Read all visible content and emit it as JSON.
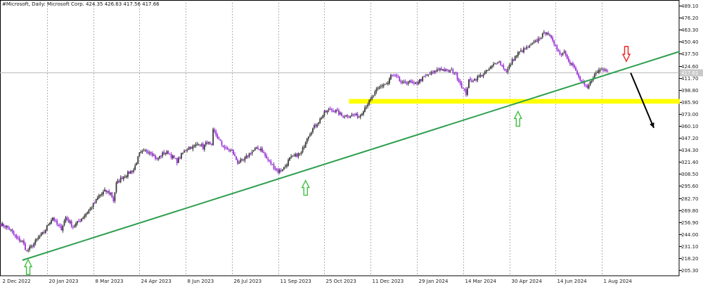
{
  "chart_data": {
    "type": "candlestick",
    "header": "#Microsoft, Daily:  Microsoft Corp.   424.35 426.63 417.56 417.66",
    "current_price_label": "417.61",
    "current_price": 417.61,
    "ylim": [
      199.3,
      495.2
    ],
    "y_ticks": [
      {
        "value": 489.1,
        "label": "489.10"
      },
      {
        "value": 476.2,
        "label": "476.20"
      },
      {
        "value": 463.3,
        "label": "463.30"
      },
      {
        "value": 450.4,
        "label": "450.40"
      },
      {
        "value": 437.5,
        "label": "437.50"
      },
      {
        "value": 424.6,
        "label": "424.60"
      },
      {
        "value": 411.7,
        "label": "411.70"
      },
      {
        "value": 398.8,
        "label": "398.80"
      },
      {
        "value": 385.9,
        "label": "385.90"
      },
      {
        "value": 373.0,
        "label": "373.00"
      },
      {
        "value": 360.1,
        "label": "360.10"
      },
      {
        "value": 347.2,
        "label": "347.20"
      },
      {
        "value": 334.3,
        "label": "334.30"
      },
      {
        "value": 321.4,
        "label": "321.40"
      },
      {
        "value": 308.5,
        "label": "308.50"
      },
      {
        "value": 295.6,
        "label": "295.60"
      },
      {
        "value": 282.7,
        "label": "282.70"
      },
      {
        "value": 269.8,
        "label": "269.80"
      },
      {
        "value": 256.9,
        "label": "256.90"
      },
      {
        "value": 244.0,
        "label": "244.00"
      },
      {
        "value": 231.1,
        "label": "231.10"
      },
      {
        "value": 218.2,
        "label": "218.20"
      },
      {
        "value": 205.3,
        "label": "205.30"
      }
    ],
    "x_ticks": [
      {
        "bar": 0,
        "label": "2 Dec 2022"
      },
      {
        "bar": 32,
        "label": "20 Jan 2023"
      },
      {
        "bar": 64,
        "label": "8 Mar 2023"
      },
      {
        "bar": 96,
        "label": "24 Apr 2023"
      },
      {
        "bar": 128,
        "label": "8 Jun 2023"
      },
      {
        "bar": 160,
        "label": "26 Jul 2023"
      },
      {
        "bar": 192,
        "label": "11 Sep 2023"
      },
      {
        "bar": 224,
        "label": "25 Oct 2023"
      },
      {
        "bar": 256,
        "label": "11 Dec 2023"
      },
      {
        "bar": 288,
        "label": "29 Jan 2024"
      },
      {
        "bar": 320,
        "label": "14 Mar 2024"
      },
      {
        "bar": 352,
        "label": "30 Apr 2024"
      },
      {
        "bar": 384,
        "label": "14 Jun 2024"
      },
      {
        "bar": 416,
        "label": "1 Aug 2024"
      }
    ],
    "total_slots": 470,
    "close_anchors": [
      [
        0,
        255
      ],
      [
        6,
        250
      ],
      [
        11,
        239
      ],
      [
        15,
        236
      ],
      [
        18,
        225
      ],
      [
        22,
        232
      ],
      [
        26,
        240
      ],
      [
        30,
        246
      ],
      [
        33,
        255
      ],
      [
        36,
        262
      ],
      [
        39,
        254
      ],
      [
        42,
        250
      ],
      [
        45,
        262
      ],
      [
        50,
        252
      ],
      [
        55,
        259
      ],
      [
        60,
        268
      ],
      [
        64,
        275
      ],
      [
        68,
        285
      ],
      [
        72,
        290
      ],
      [
        76,
        288
      ],
      [
        78,
        280
      ],
      [
        80,
        298
      ],
      [
        84,
        305
      ],
      [
        88,
        309
      ],
      [
        92,
        313
      ],
      [
        96,
        330
      ],
      [
        100,
        333
      ],
      [
        104,
        332
      ],
      [
        108,
        324
      ],
      [
        112,
        330
      ],
      [
        116,
        332
      ],
      [
        118,
        328
      ],
      [
        122,
        322
      ],
      [
        126,
        331
      ],
      [
        130,
        337
      ],
      [
        134,
        338
      ],
      [
        137,
        342
      ],
      [
        140,
        337
      ],
      [
        143,
        343
      ],
      [
        146,
        338
      ],
      [
        147,
        355
      ],
      [
        150,
        348
      ],
      [
        153,
        340
      ],
      [
        156,
        335
      ],
      [
        160,
        333
      ],
      [
        164,
        321
      ],
      [
        168,
        323
      ],
      [
        172,
        330
      ],
      [
        176,
        335
      ],
      [
        180,
        336
      ],
      [
        184,
        325
      ],
      [
        188,
        318
      ],
      [
        192,
        311
      ],
      [
        196,
        315
      ],
      [
        200,
        325
      ],
      [
        204,
        328
      ],
      [
        208,
        331
      ],
      [
        212,
        348
      ],
      [
        216,
        357
      ],
      [
        220,
        365
      ],
      [
        224,
        374
      ],
      [
        228,
        378
      ],
      [
        232,
        376
      ],
      [
        236,
        371
      ],
      [
        240,
        371
      ],
      [
        244,
        372
      ],
      [
        248,
        370
      ],
      [
        252,
        380
      ],
      [
        256,
        388
      ],
      [
        260,
        398
      ],
      [
        264,
        404
      ],
      [
        268,
        406
      ],
      [
        270,
        414
      ],
      [
        274,
        412
      ],
      [
        278,
        405
      ],
      [
        282,
        408
      ],
      [
        286,
        404
      ],
      [
        288,
        407
      ],
      [
        292,
        411
      ],
      [
        296,
        415
      ],
      [
        300,
        418
      ],
      [
        304,
        422
      ],
      [
        308,
        419
      ],
      [
        312,
        419
      ],
      [
        314,
        418
      ],
      [
        318,
        406
      ],
      [
        320,
        400
      ],
      [
        322,
        395
      ],
      [
        324,
        408
      ],
      [
        328,
        410
      ],
      [
        332,
        414
      ],
      [
        336,
        418
      ],
      [
        340,
        424
      ],
      [
        344,
        430
      ],
      [
        348,
        423
      ],
      [
        350,
        418
      ],
      [
        354,
        430
      ],
      [
        358,
        438
      ],
      [
        362,
        442
      ],
      [
        366,
        445
      ],
      [
        370,
        450
      ],
      [
        374,
        456
      ],
      [
        378,
        462
      ],
      [
        382,
        450
      ],
      [
        384,
        447
      ],
      [
        387,
        437
      ],
      [
        390,
        440
      ],
      [
        394,
        428
      ],
      [
        396,
        425
      ],
      [
        400,
        412
      ],
      [
        403,
        405
      ],
      [
        406,
        400
      ],
      [
        410,
        413
      ],
      [
        414,
        420
      ],
      [
        418,
        422
      ],
      [
        420,
        419
      ]
    ],
    "annotations": {
      "trendline": {
        "from": {
          "bar": 15,
          "value": 216
        },
        "to": {
          "bar": 470,
          "value": 440
        },
        "color": "#2e9e4e"
      },
      "resistance_zone": {
        "from_bar": 241,
        "to_bar": 470,
        "low": 384,
        "high": 389,
        "color": "#ffff00"
      },
      "up_arrows": [
        {
          "bar": 19,
          "value": 206
        },
        {
          "bar": 211,
          "value": 291
        },
        {
          "bar": 358,
          "value": 365
        }
      ],
      "down_arrow": {
        "bar": 433,
        "value": 440
      },
      "projection_arrow": {
        "from": {
          "bar": 436,
          "value": 417
        },
        "to": {
          "bar": 452,
          "value": 358
        }
      }
    },
    "colors": {
      "bull": "#3a3a3a",
      "bear": "#9b30d8",
      "grid": "#555555",
      "price_line": "#bbbbbb",
      "price_label_bg": "#c8c8c8",
      "up_arrow": "#3fbf3f",
      "down_arrow": "#ee2222",
      "projection": "#000000"
    }
  }
}
